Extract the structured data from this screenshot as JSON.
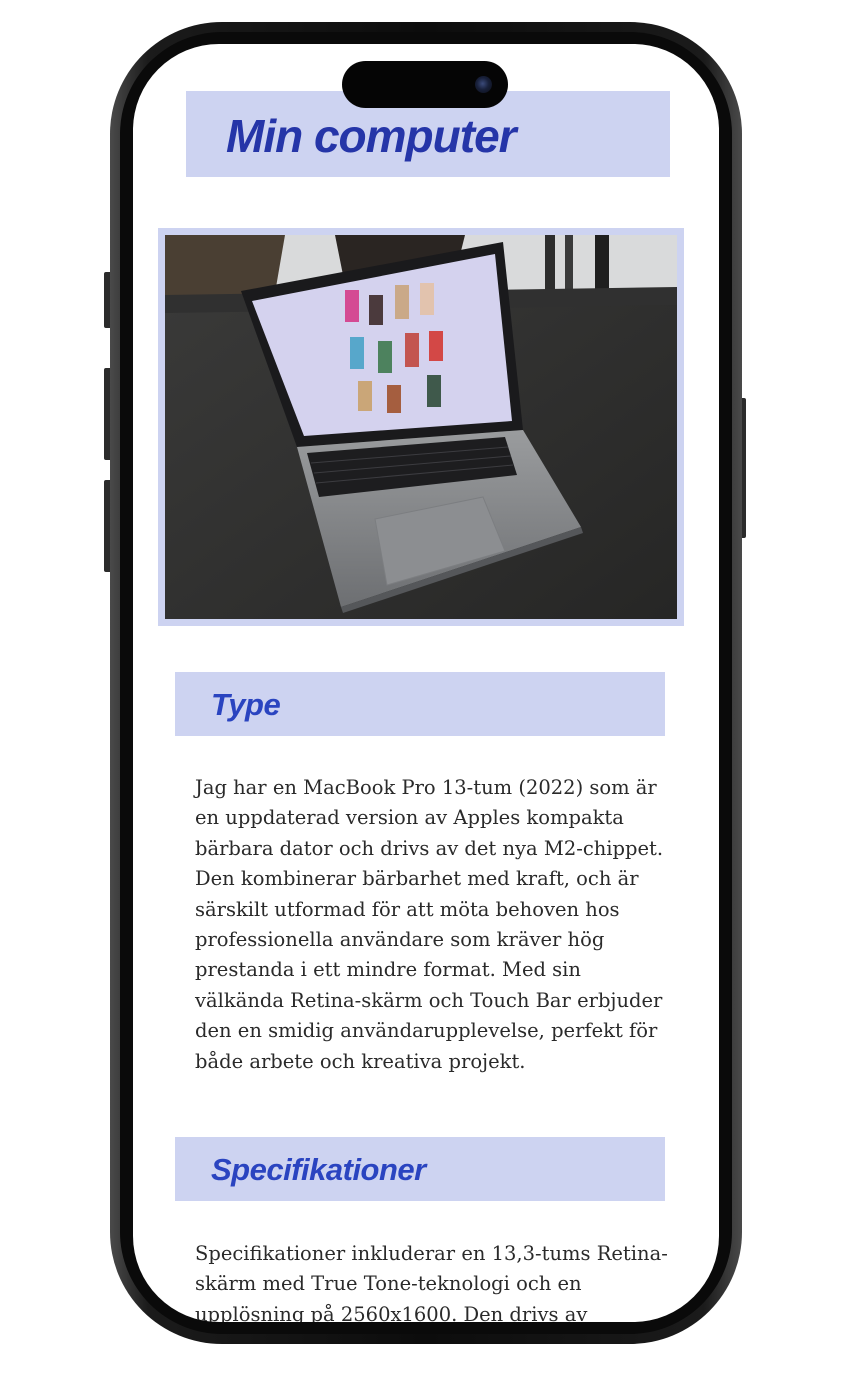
{
  "page": {
    "title": "Min computer",
    "image": {
      "alt": "MacBook Pro on a table"
    },
    "sections": [
      {
        "heading": "Type",
        "body": "Jag har en MacBook Pro 13-tum (2022) som är en uppdaterad version av Apples kompakta bärbara dator och drivs av det nya M2-chippet. Den kombinerar bärbarhet med kraft, och är särskilt utformad för att möta behoven hos professionella användare som kräver hög prestanda i ett mindre format. Med sin välkända Retina-skärm och Touch Bar erbjuder den en smidig användarupplevelse, perfekt för både arbete och kreativa projekt."
      },
      {
        "heading": "Specifikationer",
        "body": "Specifikationer inkluderar en 13,3-tums Retina-skärm med True Tone-teknologi och en upplösning på 2560x1600. Den drivs av"
      }
    ]
  },
  "colors": {
    "header_bg": "#cdd3f1",
    "title_text": "#2535a8",
    "heading_text": "#2a44c0"
  }
}
